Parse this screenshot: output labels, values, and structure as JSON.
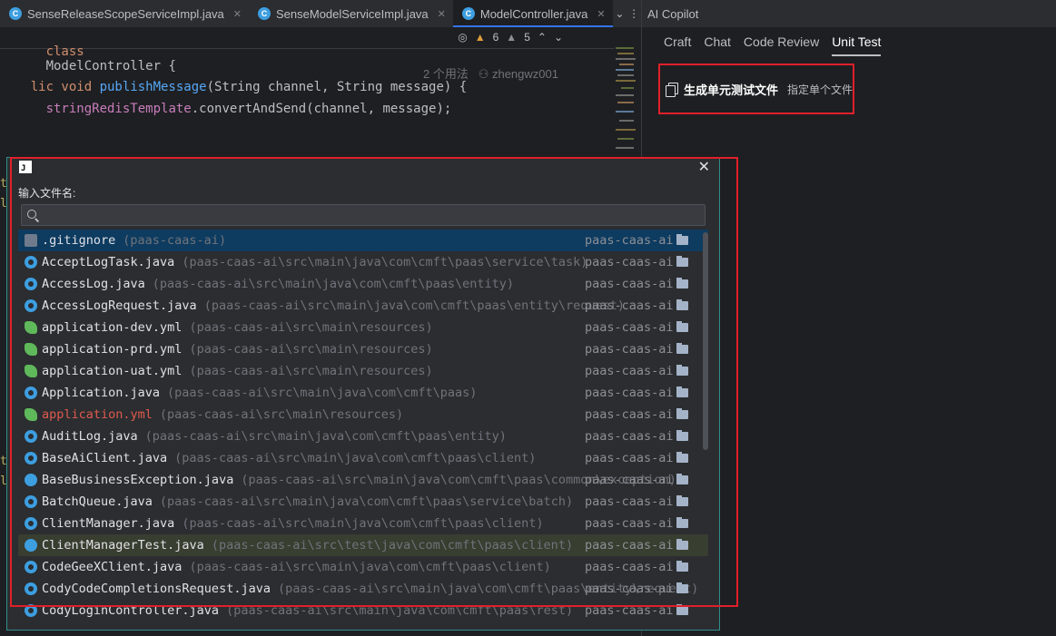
{
  "tabs": [
    {
      "label": "SenseReleaseScopeServiceImpl.java",
      "active": false
    },
    {
      "label": "SenseModelServiceImpl.java",
      "active": false
    },
    {
      "label": "ModelController.java",
      "active": true
    }
  ],
  "editor": {
    "sticky_class_kw": "class",
    "sticky_class_name": "ModelController {",
    "warnings": "6",
    "weak_warnings": "5",
    "line1_prefix": "lic void ",
    "line1_fn": "publishMessage",
    "line1_rest": "(String channel, String message) {",
    "line1_hint_usages": "2 个用法",
    "line1_hint_author": "zhengwz001",
    "line2_field": "stringRedisTemplate",
    "line2_rest": ".convertAndSend(channel, message);"
  },
  "ai_panel": {
    "title": "AI Copilot",
    "tabs": [
      {
        "label": "Craft",
        "active": false
      },
      {
        "label": "Chat",
        "active": false
      },
      {
        "label": "Code Review",
        "active": false
      },
      {
        "label": "Unit Test",
        "active": true
      }
    ],
    "generate_label": "生成单元测试文件",
    "generate_sub": "指定单个文件"
  },
  "popup": {
    "label": "输入文件名:",
    "search_value": "",
    "files": [
      {
        "name": ".gitignore",
        "path": "(paas-caas-ai)",
        "module": "paas-caas-ai",
        "icon": "gitignore-icon"
      },
      {
        "name": "AcceptLogTask.java",
        "path": "(paas-caas-ai\\src\\main\\java\\com\\cmft\\paas\\service\\task)",
        "module": "paas-caas-ai",
        "icon": "class-icon"
      },
      {
        "name": "AccessLog.java",
        "path": "(paas-caas-ai\\src\\main\\java\\com\\cmft\\paas\\entity)",
        "module": "paas-caas-ai",
        "icon": "class-icon"
      },
      {
        "name": "AccessLogRequest.java",
        "path": "(paas-caas-ai\\src\\main\\java\\com\\cmft\\paas\\entity\\request)",
        "module": "paas-caas-ai",
        "icon": "class-icon"
      },
      {
        "name": "application-dev.yml",
        "path": "(paas-caas-ai\\src\\main\\resources)",
        "module": "paas-caas-ai",
        "icon": "yml-icon"
      },
      {
        "name": "application-prd.yml",
        "path": "(paas-caas-ai\\src\\main\\resources)",
        "module": "paas-caas-ai",
        "icon": "yml-icon"
      },
      {
        "name": "application-uat.yml",
        "path": "(paas-caas-ai\\src\\main\\resources)",
        "module": "paas-caas-ai",
        "icon": "yml-icon"
      },
      {
        "name": "Application.java",
        "path": "(paas-caas-ai\\src\\main\\java\\com\\cmft\\paas)",
        "module": "paas-caas-ai",
        "icon": "class-icon"
      },
      {
        "name": "application.yml",
        "path": "(paas-caas-ai\\src\\main\\resources)",
        "module": "paas-caas-ai",
        "icon": "yml-icon"
      },
      {
        "name": "AuditLog.java",
        "path": "(paas-caas-ai\\src\\main\\java\\com\\cmft\\paas\\entity)",
        "module": "paas-caas-ai",
        "icon": "class-icon"
      },
      {
        "name": "BaseAiClient.java",
        "path": "(paas-caas-ai\\src\\main\\java\\com\\cmft\\paas\\client)",
        "module": "paas-caas-ai",
        "icon": "class-icon"
      },
      {
        "name": "BaseBusinessException.java",
        "path": "(paas-caas-ai\\src\\main\\java\\com\\cmft\\paas\\common\\exception)",
        "module": "paas-caas-ai",
        "icon": "exception-icon"
      },
      {
        "name": "BatchQueue.java",
        "path": "(paas-caas-ai\\src\\main\\java\\com\\cmft\\paas\\service\\batch)",
        "module": "paas-caas-ai",
        "icon": "class-icon"
      },
      {
        "name": "ClientManager.java",
        "path": "(paas-caas-ai\\src\\main\\java\\com\\cmft\\paas\\client)",
        "module": "paas-caas-ai",
        "icon": "class-icon"
      },
      {
        "name": "ClientManagerTest.java",
        "path": "(paas-caas-ai\\src\\test\\java\\com\\cmft\\paas\\client)",
        "module": "paas-caas-ai",
        "icon": "test-class-icon"
      },
      {
        "name": "CodeGeeXClient.java",
        "path": "(paas-caas-ai\\src\\main\\java\\com\\cmft\\paas\\client)",
        "module": "paas-caas-ai",
        "icon": "class-icon"
      },
      {
        "name": "CodyCodeCompletionsRequest.java",
        "path": "(paas-caas-ai\\src\\main\\java\\com\\cmft\\paas\\entity\\request)",
        "module": "paas-caas-ai",
        "icon": "class-icon"
      },
      {
        "name": "CodyLoginController.java",
        "path": "(paas-caas-ai\\src\\main\\java\\com\\cmft\\paas\\rest)",
        "module": "paas-caas-ai",
        "icon": "class-icon"
      }
    ]
  }
}
